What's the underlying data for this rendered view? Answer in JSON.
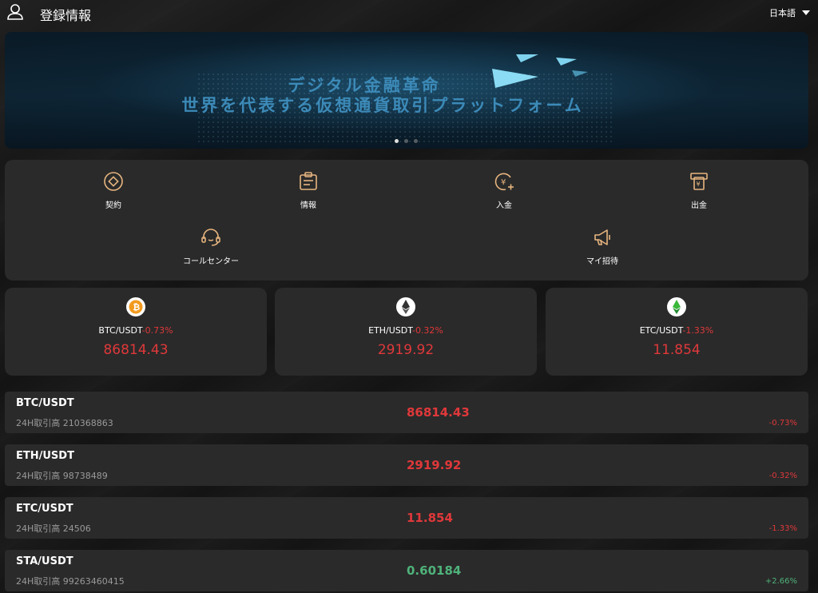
{
  "header": {
    "title": "登録情報",
    "language": "日本語",
    "user_icon": "user-icon",
    "dropdown_icon": "caret-down-icon"
  },
  "banner": {
    "line1": "デジタル金融革命",
    "line2": "世界を代表する仮想通貨取引プラットフォーム",
    "slides": 3,
    "active_slide": 1
  },
  "quick_menu": {
    "contract": "契約",
    "info": "情報",
    "deposit": "入金",
    "withdraw": "出金",
    "call_center": "コールセンター",
    "invite": "マイ招待"
  },
  "tickers": [
    {
      "pair": "BTC/USDT",
      "change": "-0.73%",
      "price": "86814.43",
      "icon": "bitcoin-icon"
    },
    {
      "pair": "ETH/USDT",
      "change": "-0.32%",
      "price": "2919.92",
      "icon": "ethereum-icon"
    },
    {
      "pair": "ETC/USDT",
      "change": "-1.33%",
      "price": "11.854",
      "icon": "ethereum-classic-icon"
    }
  ],
  "markets": [
    {
      "pair": "BTC/USDT",
      "volume": "24H取引高 210368863",
      "price": "86814.43",
      "change": "-0.73%"
    },
    {
      "pair": "ETH/USDT",
      "volume": "24H取引高 98738489",
      "price": "2919.92",
      "change": "-0.32%"
    },
    {
      "pair": "ETC/USDT",
      "volume": "24H取引高 24506",
      "price": "11.854",
      "change": "-1.33%"
    },
    {
      "pair": "STA/USDT",
      "volume": "24H取引高 99263460415",
      "price": "0.60184",
      "change": "+2.66%"
    }
  ],
  "colors": {
    "down": "#e0383a",
    "up": "#4fb27a",
    "accent_icon": "#e7b57f",
    "card_bg": "#2a2a2a"
  }
}
